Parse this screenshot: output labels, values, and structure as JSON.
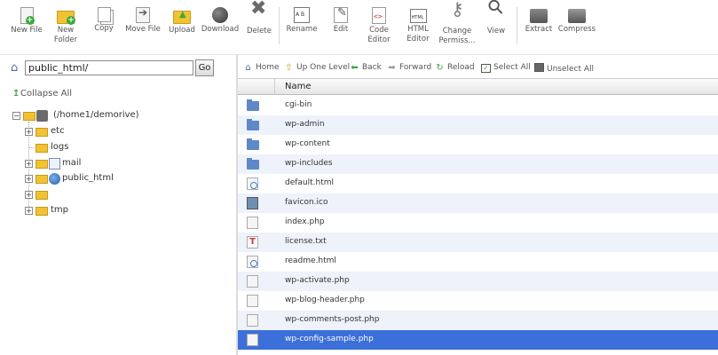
{
  "toolbar": {
    "buttons": [
      {
        "label": "New File"
      },
      {
        "label": "New\nFolder"
      },
      {
        "label": "Copy"
      },
      {
        "label": "Move File"
      },
      {
        "label": "Upload"
      },
      {
        "label": "Download"
      },
      {
        "label": "Delete"
      },
      {
        "label": "Rename"
      },
      {
        "label": "Edit"
      },
      {
        "label": "Code\nEditor"
      },
      {
        "label": "HTML\nEditor"
      },
      {
        "label": "Change\nPermiss..."
      },
      {
        "label": "View"
      },
      {
        "label": "Extract"
      },
      {
        "label": "Compress"
      }
    ]
  },
  "path": {
    "value": "public_html/",
    "go_label": "Go"
  },
  "tree": {
    "collapse_label": "Collapse All",
    "root_label": "(/home1/demorive)",
    "items": [
      {
        "label": "etc"
      },
      {
        "label": "logs"
      },
      {
        "label": "mail"
      },
      {
        "label": "public_html"
      },
      {
        "label": ""
      },
      {
        "label": "tmp"
      }
    ]
  },
  "nav": {
    "home": "Home",
    "up": "Up One Level",
    "back": "Back",
    "forward": "Forward",
    "reload": "Reload",
    "select_all": "Select All",
    "unselect_all": "Unselect All"
  },
  "table": {
    "header_name": "Name",
    "rows": [
      {
        "name": "cgi-bin",
        "icon": "folder-icon"
      },
      {
        "name": "wp-admin",
        "icon": "folder-icon"
      },
      {
        "name": "wp-content",
        "icon": "folder-icon"
      },
      {
        "name": "wp-includes",
        "icon": "folder-icon"
      },
      {
        "name": "default.html",
        "icon": "html-file-icon"
      },
      {
        "name": "favicon.ico",
        "icon": "image-file-icon"
      },
      {
        "name": "index.php",
        "icon": "file-icon"
      },
      {
        "name": "license.txt",
        "icon": "text-file-icon"
      },
      {
        "name": "readme.html",
        "icon": "html-file-icon"
      },
      {
        "name": "wp-activate.php",
        "icon": "file-icon"
      },
      {
        "name": "wp-blog-header.php",
        "icon": "file-icon"
      },
      {
        "name": "wp-comments-post.php",
        "icon": "file-icon"
      },
      {
        "name": "wp-config-sample.php",
        "icon": "file-icon"
      }
    ]
  },
  "colors": {
    "selected_row": "#3c6fd9",
    "alt_row": "#eef2fa",
    "folder_blue": "#5f88c9",
    "tree_folder": "#f1c232"
  }
}
